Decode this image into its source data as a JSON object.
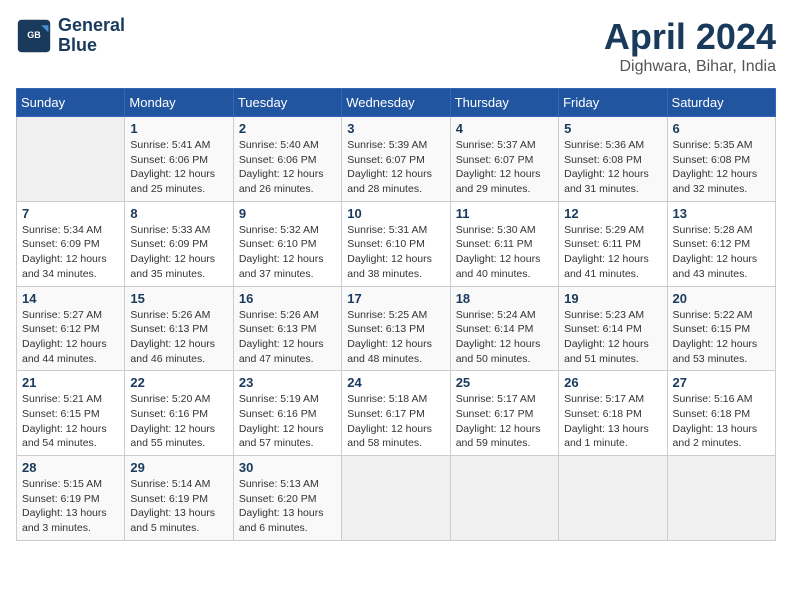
{
  "header": {
    "logo_line1": "General",
    "logo_line2": "Blue",
    "title": "April 2024",
    "subtitle": "Dighwara, Bihar, India"
  },
  "weekdays": [
    "Sunday",
    "Monday",
    "Tuesday",
    "Wednesday",
    "Thursday",
    "Friday",
    "Saturday"
  ],
  "weeks": [
    [
      {
        "day": "",
        "info": ""
      },
      {
        "day": "1",
        "info": "Sunrise: 5:41 AM\nSunset: 6:06 PM\nDaylight: 12 hours\nand 25 minutes."
      },
      {
        "day": "2",
        "info": "Sunrise: 5:40 AM\nSunset: 6:06 PM\nDaylight: 12 hours\nand 26 minutes."
      },
      {
        "day": "3",
        "info": "Sunrise: 5:39 AM\nSunset: 6:07 PM\nDaylight: 12 hours\nand 28 minutes."
      },
      {
        "day": "4",
        "info": "Sunrise: 5:37 AM\nSunset: 6:07 PM\nDaylight: 12 hours\nand 29 minutes."
      },
      {
        "day": "5",
        "info": "Sunrise: 5:36 AM\nSunset: 6:08 PM\nDaylight: 12 hours\nand 31 minutes."
      },
      {
        "day": "6",
        "info": "Sunrise: 5:35 AM\nSunset: 6:08 PM\nDaylight: 12 hours\nand 32 minutes."
      }
    ],
    [
      {
        "day": "7",
        "info": "Sunrise: 5:34 AM\nSunset: 6:09 PM\nDaylight: 12 hours\nand 34 minutes."
      },
      {
        "day": "8",
        "info": "Sunrise: 5:33 AM\nSunset: 6:09 PM\nDaylight: 12 hours\nand 35 minutes."
      },
      {
        "day": "9",
        "info": "Sunrise: 5:32 AM\nSunset: 6:10 PM\nDaylight: 12 hours\nand 37 minutes."
      },
      {
        "day": "10",
        "info": "Sunrise: 5:31 AM\nSunset: 6:10 PM\nDaylight: 12 hours\nand 38 minutes."
      },
      {
        "day": "11",
        "info": "Sunrise: 5:30 AM\nSunset: 6:11 PM\nDaylight: 12 hours\nand 40 minutes."
      },
      {
        "day": "12",
        "info": "Sunrise: 5:29 AM\nSunset: 6:11 PM\nDaylight: 12 hours\nand 41 minutes."
      },
      {
        "day": "13",
        "info": "Sunrise: 5:28 AM\nSunset: 6:12 PM\nDaylight: 12 hours\nand 43 minutes."
      }
    ],
    [
      {
        "day": "14",
        "info": "Sunrise: 5:27 AM\nSunset: 6:12 PM\nDaylight: 12 hours\nand 44 minutes."
      },
      {
        "day": "15",
        "info": "Sunrise: 5:26 AM\nSunset: 6:13 PM\nDaylight: 12 hours\nand 46 minutes."
      },
      {
        "day": "16",
        "info": "Sunrise: 5:26 AM\nSunset: 6:13 PM\nDaylight: 12 hours\nand 47 minutes."
      },
      {
        "day": "17",
        "info": "Sunrise: 5:25 AM\nSunset: 6:13 PM\nDaylight: 12 hours\nand 48 minutes."
      },
      {
        "day": "18",
        "info": "Sunrise: 5:24 AM\nSunset: 6:14 PM\nDaylight: 12 hours\nand 50 minutes."
      },
      {
        "day": "19",
        "info": "Sunrise: 5:23 AM\nSunset: 6:14 PM\nDaylight: 12 hours\nand 51 minutes."
      },
      {
        "day": "20",
        "info": "Sunrise: 5:22 AM\nSunset: 6:15 PM\nDaylight: 12 hours\nand 53 minutes."
      }
    ],
    [
      {
        "day": "21",
        "info": "Sunrise: 5:21 AM\nSunset: 6:15 PM\nDaylight: 12 hours\nand 54 minutes."
      },
      {
        "day": "22",
        "info": "Sunrise: 5:20 AM\nSunset: 6:16 PM\nDaylight: 12 hours\nand 55 minutes."
      },
      {
        "day": "23",
        "info": "Sunrise: 5:19 AM\nSunset: 6:16 PM\nDaylight: 12 hours\nand 57 minutes."
      },
      {
        "day": "24",
        "info": "Sunrise: 5:18 AM\nSunset: 6:17 PM\nDaylight: 12 hours\nand 58 minutes."
      },
      {
        "day": "25",
        "info": "Sunrise: 5:17 AM\nSunset: 6:17 PM\nDaylight: 12 hours\nand 59 minutes."
      },
      {
        "day": "26",
        "info": "Sunrise: 5:17 AM\nSunset: 6:18 PM\nDaylight: 13 hours\nand 1 minute."
      },
      {
        "day": "27",
        "info": "Sunrise: 5:16 AM\nSunset: 6:18 PM\nDaylight: 13 hours\nand 2 minutes."
      }
    ],
    [
      {
        "day": "28",
        "info": "Sunrise: 5:15 AM\nSunset: 6:19 PM\nDaylight: 13 hours\nand 3 minutes."
      },
      {
        "day": "29",
        "info": "Sunrise: 5:14 AM\nSunset: 6:19 PM\nDaylight: 13 hours\nand 5 minutes."
      },
      {
        "day": "30",
        "info": "Sunrise: 5:13 AM\nSunset: 6:20 PM\nDaylight: 13 hours\nand 6 minutes."
      },
      {
        "day": "",
        "info": ""
      },
      {
        "day": "",
        "info": ""
      },
      {
        "day": "",
        "info": ""
      },
      {
        "day": "",
        "info": ""
      }
    ]
  ]
}
